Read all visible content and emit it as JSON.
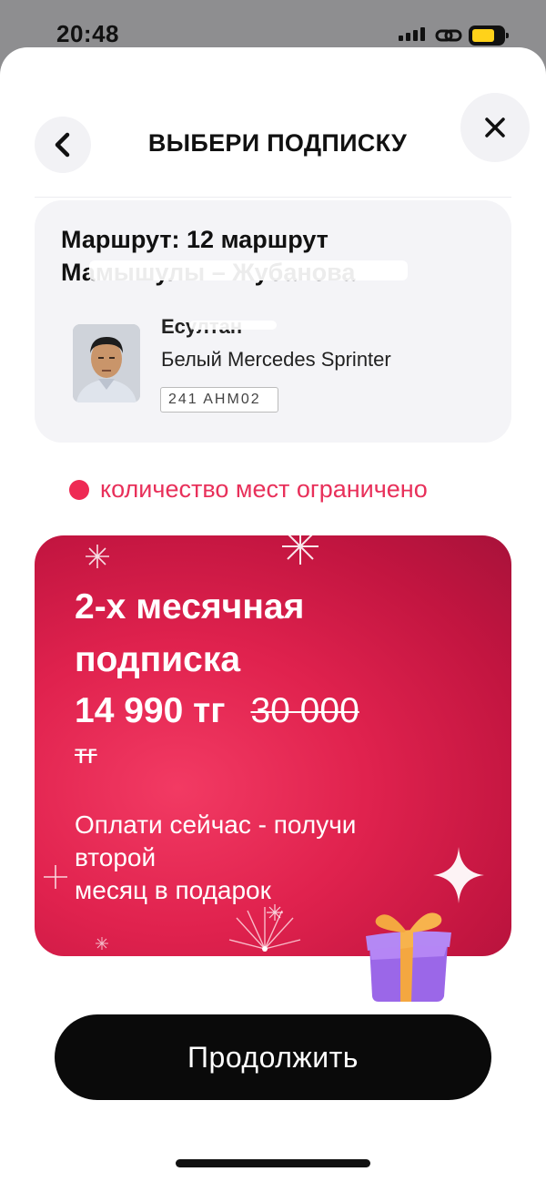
{
  "status_bar": {
    "time": "20:48"
  },
  "header": {
    "title": "ВЫБЕРИ ПОДПИСКУ"
  },
  "route_card": {
    "route_label": "Маршрут: 12 маршрут",
    "route_stops": "Мамышулы – Жубанова",
    "driver_name": "Есултан",
    "vehicle": "Белый Mercedes Sprinter",
    "plate": "241 AHM02"
  },
  "availability": {
    "text": "количество мест ограничено",
    "dot_color": "#ee2a54"
  },
  "promo": {
    "title": "2-х месячная подписка",
    "price": "14 990 тг",
    "old_price": "30 000",
    "old_currency": "тг",
    "desc_line1": "Оплати сейчас - получи второй",
    "desc_line2": "месяц в подарок",
    "background": "#e0224e"
  },
  "continue_button": {
    "label": "Продолжить"
  }
}
